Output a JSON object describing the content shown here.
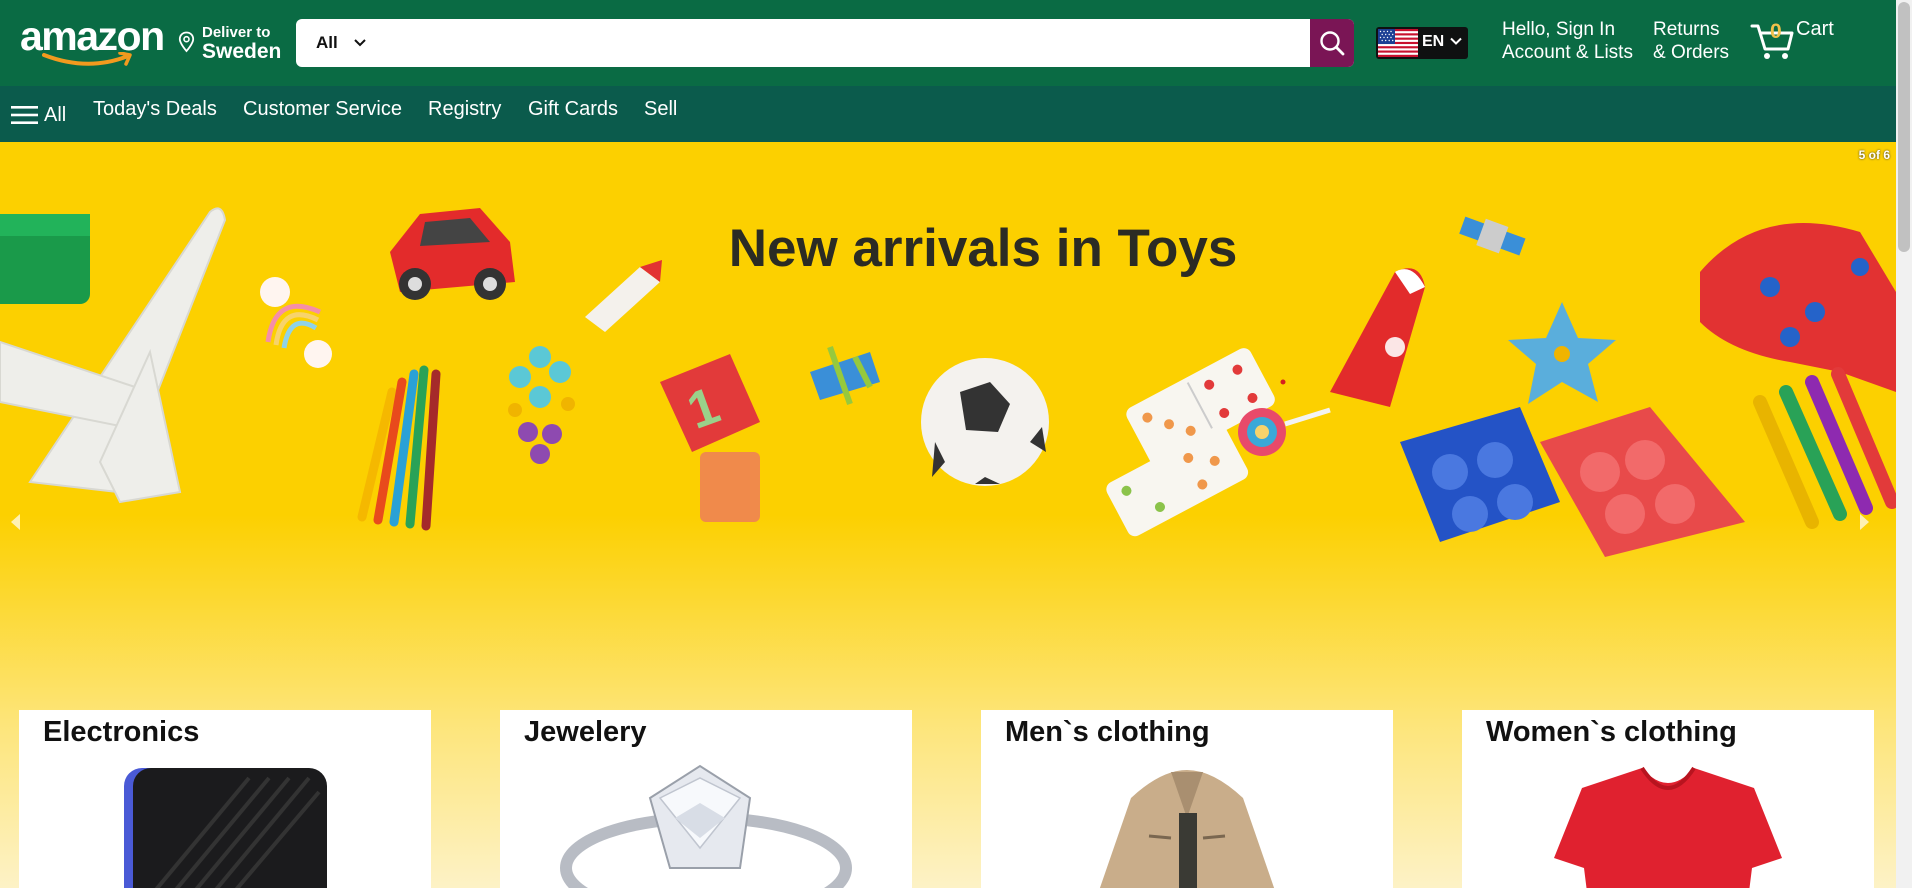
{
  "header": {
    "logo_text": "amazon",
    "deliver_line1": "Deliver to",
    "deliver_line2": "Sweden",
    "search_category": "All",
    "search_placeholder": "",
    "language_code": "EN",
    "account_line1": "Hello, Sign In",
    "account_line2": "Account & Lists",
    "returns_line1": "Returns",
    "returns_line2": "& Orders",
    "cart_count": "0",
    "cart_label": "Cart",
    "colors": {
      "header_bg": "#0a6b44",
      "search_button": "#7a1555",
      "cart_count": "#f0c14b"
    }
  },
  "nav": {
    "all_label": "All",
    "items": [
      "Today's Deals",
      "Customer Service",
      "Registry",
      "Gift Cards",
      "Sell"
    ],
    "colors": {
      "nav_bg": "#0b5b4c"
    }
  },
  "hero": {
    "title": "New arrivals in Toys",
    "slide_indicator": "5 of 6",
    "background_color": "#fcd000"
  },
  "categories": [
    {
      "title": "Electronics",
      "icon": "hard-drive-image"
    },
    {
      "title": "Jewelery",
      "icon": "diamond-ring-image"
    },
    {
      "title": "Men`s clothing",
      "icon": "jacket-image"
    },
    {
      "title": "Women`s clothing",
      "icon": "tshirt-image"
    }
  ]
}
